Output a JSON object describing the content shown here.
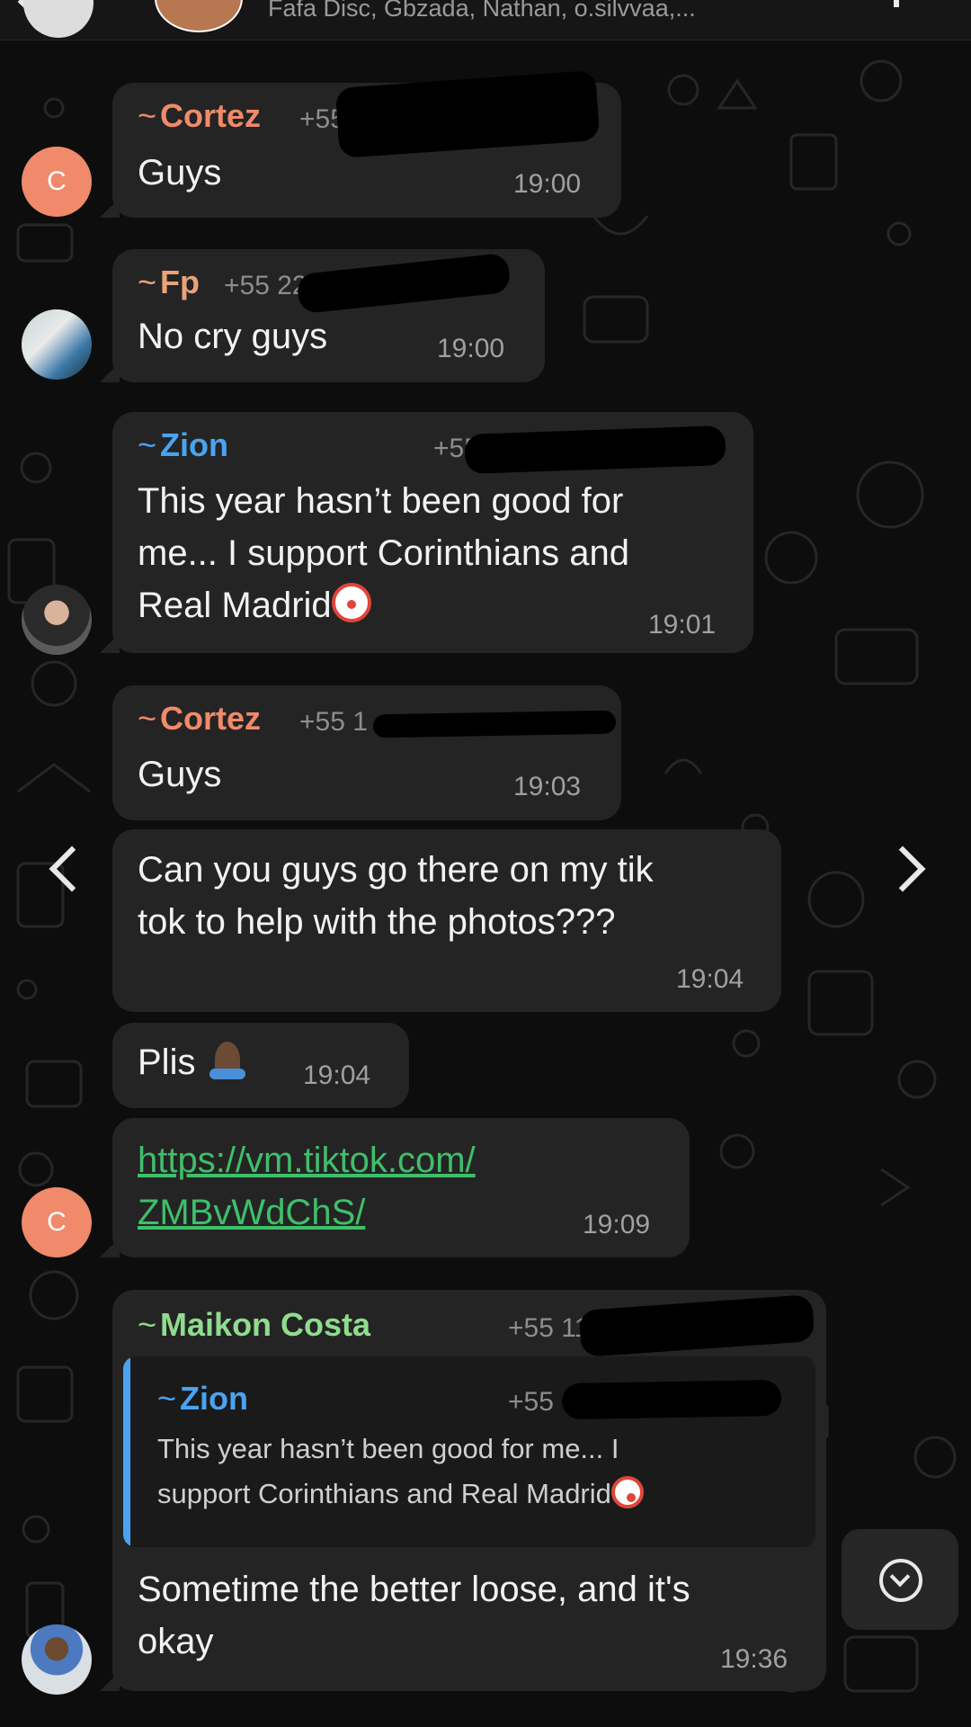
{
  "header": {
    "members": "Fafa Disc, Gbzada, Nathan, o.silvvaa,..."
  },
  "avatar_letter": "C",
  "messages": [
    {
      "sender": "Cortez",
      "phone": "+55 1",
      "text": "Guys",
      "time": "19:00"
    },
    {
      "sender": "Fp",
      "phone": "+55 22",
      "text": "No cry guys",
      "time": "19:00"
    },
    {
      "sender": "Zion",
      "phone": "+55",
      "text_lines": [
        "This year hasn’t been good for",
        "me... I support Corinthians and",
        "Real Madrid"
      ],
      "time": "19:01"
    },
    {
      "sender": "Cortez",
      "phone": "+55 1",
      "text": "Guys",
      "time": "19:03"
    },
    {
      "text_lines": [
        "Can you guys go there on my tik",
        "tok to help with the photos???"
      ],
      "time": "19:04"
    },
    {
      "text": "Plis",
      "time": "19:04"
    },
    {
      "link_lines": [
        "https://vm.tiktok.com/",
        "ZMBvWdChS/"
      ],
      "time": "19:09"
    },
    {
      "sender": "Maikon Costa",
      "phone": "+55 11",
      "quote": {
        "sender": "Zion",
        "phone": "+55 9",
        "text_lines": [
          "This year hasn’t been good for me... I",
          "support Corinthians and Real Madrid"
        ]
      },
      "text_lines": [
        "Sometime the better loose, and it's",
        "okay"
      ],
      "time": "19:36"
    }
  ],
  "colors": {
    "cortez": "#f08a6b",
    "fp": "#e9a37a",
    "zion": "#4aa3f0",
    "maikon": "#8fdc8f",
    "link": "#3fbf6a",
    "bubble": "#242424"
  },
  "icons": [
    "back-chevron-icon",
    "prev-arrow-icon",
    "next-arrow-icon",
    "scroll-down-icon",
    "clown-emoji",
    "praying-hands-emoji"
  ]
}
